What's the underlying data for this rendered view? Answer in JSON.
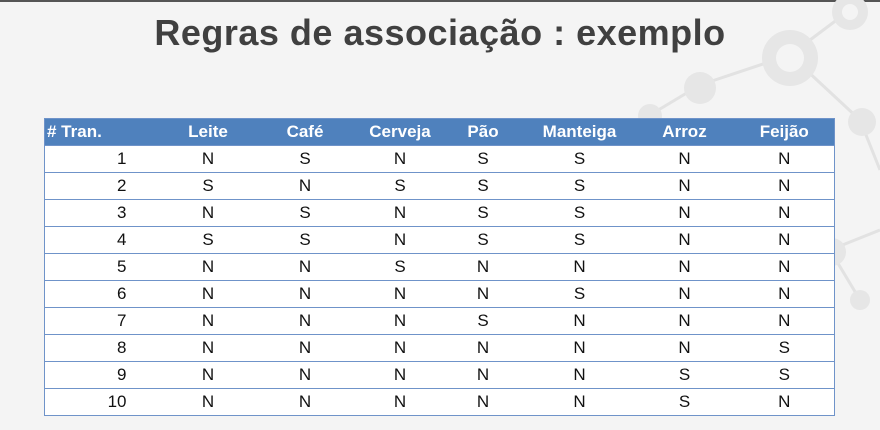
{
  "slide": {
    "title": "Regras de associação : exemplo"
  },
  "table": {
    "headers": [
      "# Tran.",
      "Leite",
      "Café",
      "Cerveja",
      "Pão",
      "Manteiga",
      "Arroz",
      "Feijão"
    ],
    "rows": [
      [
        "1",
        "N",
        "S",
        "N",
        "S",
        "S",
        "N",
        "N"
      ],
      [
        "2",
        "S",
        "N",
        "S",
        "S",
        "S",
        "N",
        "N"
      ],
      [
        "3",
        "N",
        "S",
        "N",
        "S",
        "S",
        "N",
        "N"
      ],
      [
        "4",
        "S",
        "S",
        "N",
        "S",
        "S",
        "N",
        "N"
      ],
      [
        "5",
        "N",
        "N",
        "S",
        "N",
        "N",
        "N",
        "N"
      ],
      [
        "6",
        "N",
        "N",
        "N",
        "N",
        "S",
        "N",
        "N"
      ],
      [
        "7",
        "N",
        "N",
        "N",
        "S",
        "N",
        "N",
        "N"
      ],
      [
        "8",
        "N",
        "N",
        "N",
        "N",
        "N",
        "N",
        "S"
      ],
      [
        "9",
        "N",
        "N",
        "N",
        "N",
        "N",
        "S",
        "S"
      ],
      [
        "10",
        "N",
        "N",
        "N",
        "N",
        "N",
        "S",
        "N"
      ]
    ]
  },
  "colors": {
    "header_bg": "#4f81bd",
    "grid_line": "#6f93c9",
    "title_text": "#404040"
  }
}
